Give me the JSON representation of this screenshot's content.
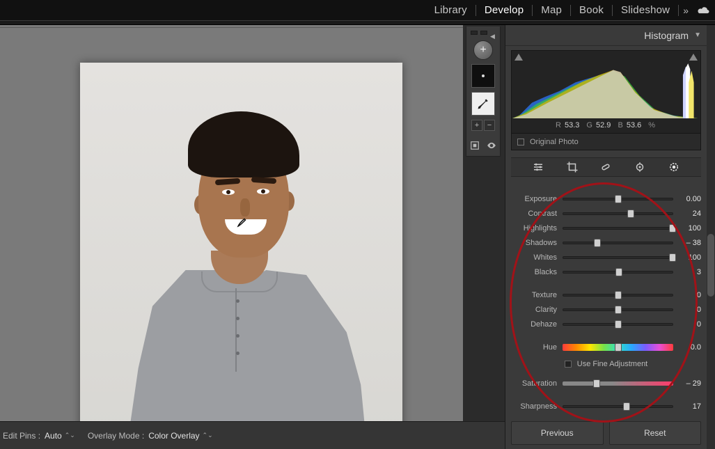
{
  "topbar": {
    "modules": [
      "Library",
      "Develop",
      "Map",
      "Book",
      "Slideshow"
    ],
    "active_index": 1
  },
  "histogram": {
    "title": "Histogram",
    "rgb": {
      "r_label": "R",
      "r": "53.3",
      "g_label": "G",
      "g": "52.9",
      "b_label": "B",
      "b": "53.6",
      "pct": "%"
    },
    "original_label": "Original Photo"
  },
  "sliders": {
    "exposure": {
      "label": "Exposure",
      "value": "0.00",
      "pos": 50
    },
    "contrast": {
      "label": "Contrast",
      "value": "24",
      "pos": 62
    },
    "highlights": {
      "label": "Highlights",
      "value": "100",
      "pos": 100
    },
    "shadows": {
      "label": "Shadows",
      "value": "– 38",
      "pos": 31
    },
    "whites": {
      "label": "Whites",
      "value": "100",
      "pos": 100
    },
    "blacks": {
      "label": "Blacks",
      "value": "3",
      "pos": 51
    },
    "texture": {
      "label": "Texture",
      "value": "0",
      "pos": 50
    },
    "clarity": {
      "label": "Clarity",
      "value": "0",
      "pos": 50
    },
    "dehaze": {
      "label": "Dehaze",
      "value": "0",
      "pos": 50
    },
    "hue": {
      "label": "Hue",
      "value": "0.0",
      "pos": 50
    },
    "fine_label": "Use Fine Adjustment",
    "saturation": {
      "label": "Saturation",
      "value": "– 29",
      "pos": 31
    },
    "sharpness": {
      "label": "Sharpness",
      "value": "17",
      "pos": 58
    }
  },
  "buttons": {
    "previous": "Previous",
    "reset": "Reset"
  },
  "bottombar": {
    "edit_pins_label": "Edit Pins :",
    "edit_pins_value": "Auto",
    "overlay_label": "Overlay Mode :",
    "overlay_value": "Color Overlay"
  }
}
